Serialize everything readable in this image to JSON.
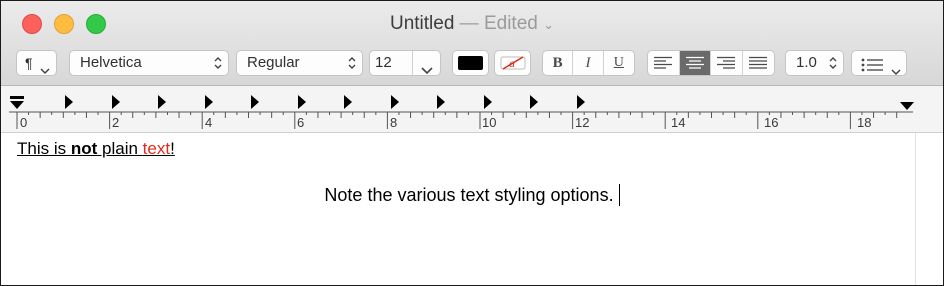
{
  "window": {
    "title": "Untitled",
    "edited": "— Edited",
    "title_chevron": "⌄"
  },
  "toolbar": {
    "paragraph_style": "¶",
    "font_family": "Helvetica",
    "font_typeface": "Regular",
    "font_size": "12",
    "text_color": "#000000",
    "bold_label": "B",
    "italic_label": "I",
    "underline_label": "U",
    "alignment_options": [
      "left",
      "center",
      "right",
      "justify"
    ],
    "alignment_selected": "center",
    "line_spacing": "1.0",
    "list_icon": "list-bullets-icon"
  },
  "ruler": {
    "labels": [
      "0",
      "2",
      "4",
      "6",
      "8",
      "10",
      "12",
      "14",
      "16",
      "18"
    ]
  },
  "document": {
    "line1": {
      "part1": "This is ",
      "bold": "not",
      "part2": " plain ",
      "red": "text",
      "part3": "!"
    },
    "line2": "Note the various text styling options."
  },
  "colors": {
    "close": "#fc605c",
    "minimize": "#fdbc40",
    "zoom": "#34c84a",
    "red_text": "#e02b1b"
  }
}
